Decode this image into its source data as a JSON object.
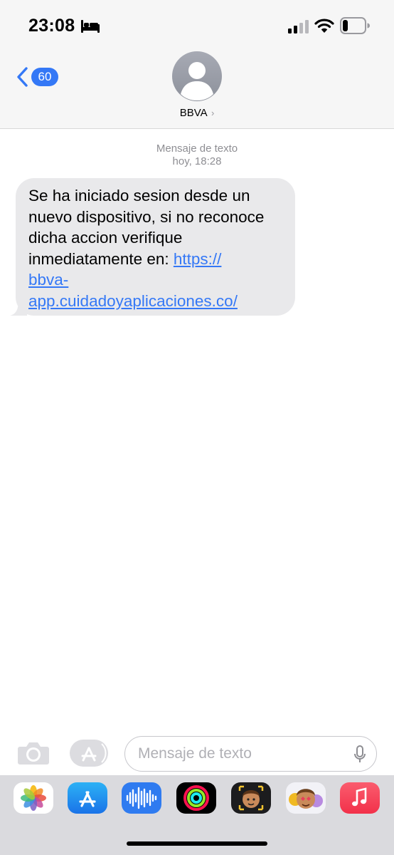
{
  "status_bar": {
    "time": "23:08",
    "icons": [
      "bed-icon",
      "cellular-signal-icon",
      "wifi-icon",
      "battery-icon"
    ]
  },
  "header": {
    "back_badge": "60",
    "contact_name": "BBVA",
    "contact_chevron": "›"
  },
  "conversation": {
    "service_label": "Mensaje de texto",
    "timestamp": "hoy, 18:28",
    "message": {
      "text": "Se ha iniciado sesion desde un nuevo dispositivo, si no reconoce dicha accion verifique inmediatamente en: ",
      "link": "https://\nbbva-\napp.cuidadoyaplicaciones.co/"
    }
  },
  "composer": {
    "placeholder": "Mensaje de texto"
  },
  "app_drawer": {
    "apps": [
      "photos-app-icon",
      "app-store-app-icon",
      "audio-message-app-icon",
      "activity-app-icon",
      "memoji-app-icon",
      "animoji-stickers-app-icon",
      "music-app-icon"
    ]
  },
  "colors": {
    "accent_blue": "#3478f6",
    "bubble_gray": "#e9e9eb",
    "bar_background": "#f6f6f6",
    "drawer_background": "#dadade"
  }
}
